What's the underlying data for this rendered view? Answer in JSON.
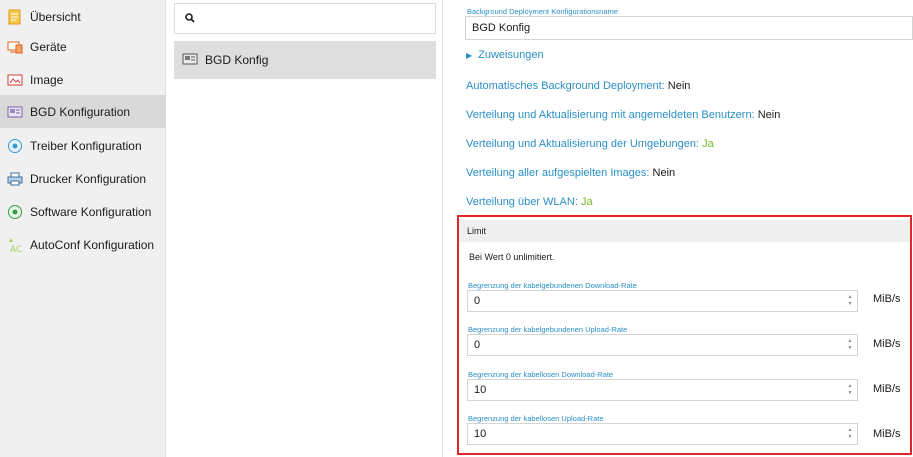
{
  "sidebar": {
    "items": [
      {
        "label": "Übersicht",
        "icon": "overview-icon",
        "active": false
      },
      {
        "label": "Geräte",
        "icon": "devices-icon",
        "active": false
      },
      {
        "label": "Image",
        "icon": "image-icon",
        "active": false
      },
      {
        "label": "BGD Konfiguration",
        "icon": "bgd-config-icon",
        "active": true
      },
      {
        "label": "Treiber Konfiguration",
        "icon": "driver-config-icon",
        "active": false
      },
      {
        "label": "Drucker Konfiguration",
        "icon": "printer-config-icon",
        "active": false
      },
      {
        "label": "Software Konfiguration",
        "icon": "software-config-icon",
        "active": false
      },
      {
        "label": "AutoConf Konfiguration",
        "icon": "autoconf-config-icon",
        "active": false
      }
    ]
  },
  "middle": {
    "search": {
      "value": "",
      "icon": "search-icon"
    },
    "list": [
      {
        "label": "BGD Konfig",
        "icon": "bgd-config-icon",
        "selected": true
      }
    ]
  },
  "detail": {
    "name_field": {
      "label": "Background Deployment Konfigurationsname",
      "value": "BGD Konfig"
    },
    "assignments_toggle": "Zuweisungen",
    "settings": [
      {
        "label": "Automatisches Background Deployment:",
        "value": "Nein",
        "positive": false
      },
      {
        "label": "Verteilung und Aktualisierung mit angemeldeten Benutzern:",
        "value": "Nein",
        "positive": false
      },
      {
        "label": "Verteilung und Aktualisierung der Umgebungen:",
        "value": "Ja",
        "positive": true
      },
      {
        "label": "Verteilung aller aufgespielten Images:",
        "value": "Nein",
        "positive": false
      },
      {
        "label": "Verteilung über WLAN:",
        "value": "Ja",
        "positive": true
      }
    ],
    "limit": {
      "title": "Limit",
      "note": "Bei Wert 0 unlimitiert.",
      "fields": [
        {
          "label": "Begrenzung der kabelgebundenen Download-Rate",
          "value": "0",
          "unit": "MiB/s"
        },
        {
          "label": "Begrenzung der kabelgebundenen Upload-Rate",
          "value": "0",
          "unit": "MiB/s"
        },
        {
          "label": "Begrenzung der kabellosen Download-Rate",
          "value": "10",
          "unit": "MiB/s"
        },
        {
          "label": "Begrenzung der kabellosen Upload-Rate",
          "value": "10",
          "unit": "MiB/s"
        }
      ]
    }
  },
  "colors": {
    "accent_blue": "#2a8fc6",
    "positive_green": "#7ab829",
    "highlight_red": "#e0262b",
    "active_nav": "#d9d9d9"
  }
}
